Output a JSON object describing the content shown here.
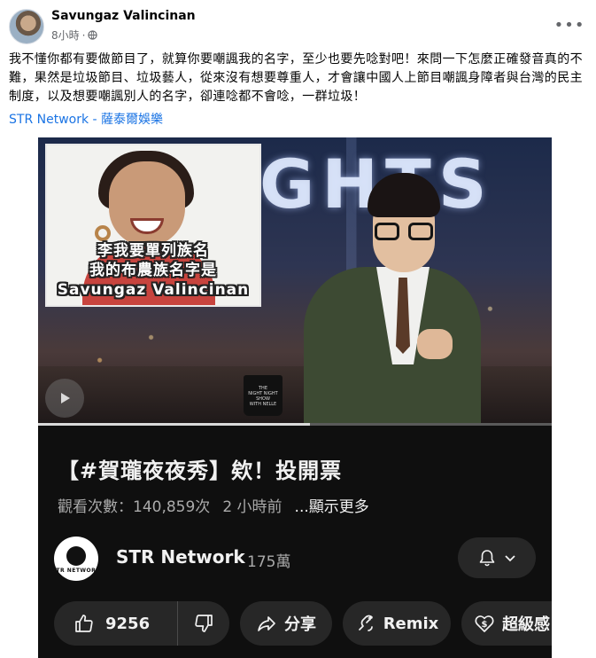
{
  "post": {
    "author": "Savungaz Valincinan",
    "time": "8小時",
    "separator": "·",
    "text": "我不懂你都有要做節目了，就算你要嘲諷我的名字，至少也要先唸對吧！來問一下怎麼正確發音真的不難，果然是垃圾節目、垃圾藝人，從來沒有想要尊重人，才會讓中國人上節目嘲諷身障者與台灣的民主制度，以及想要嘲諷別人的名字，卻連唸都不會唸，一群垃圾！",
    "link_text": "STR Network - 薩泰爾娛樂",
    "more_icon": "ellipsis-icon"
  },
  "video": {
    "inset_caption": [
      "李我要單列族名",
      "我的布農族名字是",
      "Savungaz Valincinan"
    ],
    "sign_text": "GHTS",
    "mug_text": "THE\nNIGHT NIGHT\nSHOW\nWITH NELLE",
    "progress": 0.53,
    "title": "【#賀瓏夜夜秀】欸！投開票",
    "views": "觀看次數：140,859次",
    "age": "2 小時前",
    "show_more": "...顯示更多",
    "channel_name": "STR Network",
    "channel_avatar_text": "STR NETWORK",
    "subscribers": "175萬",
    "like_count": "9256",
    "share_label": "分享",
    "remix_label": "Remix",
    "thanks_label": "超級感"
  },
  "colors": {
    "link": "#1b74e4",
    "video_bg": "#0f0f0f",
    "pill_bg": "#272727",
    "text_secondary": "#65676b"
  }
}
